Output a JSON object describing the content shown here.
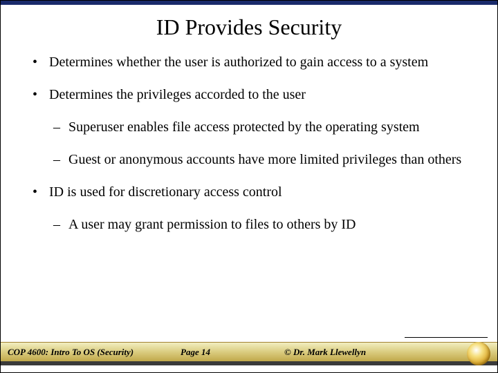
{
  "title": "ID Provides Security",
  "bullets": {
    "b1": "Determines whether the user is authorized to gain access to a system",
    "b2": "Determines the privileges accorded to the user",
    "b2a": "Superuser  enables file access protected by the operating system",
    "b2b": "Guest or anonymous accounts have more limited privileges than others",
    "b3": "ID is used for discretionary access control",
    "b3a": "A user may grant permission to files to others by ID"
  },
  "footer": {
    "left": "COP 4600: Intro To OS  (Security)",
    "center": "Page 14",
    "right": "© Dr. Mark Llewellyn"
  }
}
